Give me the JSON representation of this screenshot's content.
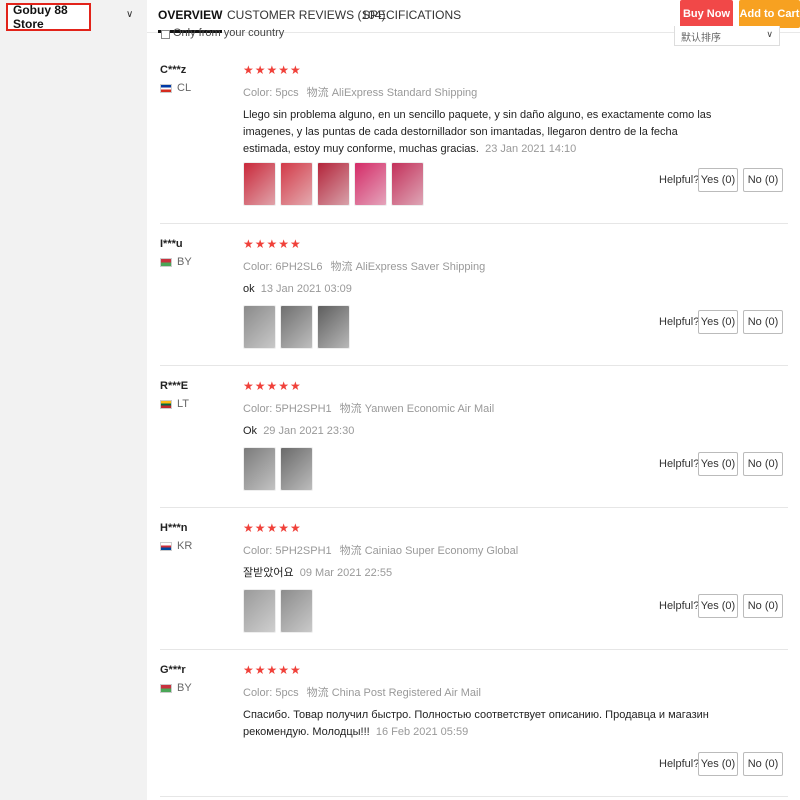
{
  "store": {
    "name": "Gobuy 88 Store",
    "chevron": "chevron-down-icon"
  },
  "tabs": [
    {
      "label": "OVERVIEW",
      "active": true
    },
    {
      "label": "CUSTOMER REVIEWS (104)",
      "active": false
    },
    {
      "label": "SPECIFICATIONS",
      "active": false
    }
  ],
  "actions": {
    "buy_now": "Buy Now",
    "add_to_cart": "Add to Cart"
  },
  "filters": {
    "country_label": "Only from your country",
    "sort_value": "默认排序"
  },
  "colors": {
    "accent": "#f14848",
    "cart": "#f7a121",
    "stars": "#f0413a"
  },
  "helpful_label": "Helpful?",
  "reviews": [
    {
      "name": "C***z",
      "country": "CL",
      "flag_colors": [
        "#0039a6",
        "#ffffff",
        "#d52b1e"
      ],
      "rating": 5,
      "stars": "★★★★★",
      "color_label": "Color:",
      "color_value": "5pcs",
      "logistics_label": "物流",
      "logistics_value": "AliExpress Standard Shipping",
      "text": "Llego sin problema alguno, en un sencillo paquete, y sin daño alguno, es exactamente como las imagenes, y las puntas de cada destornillador son imantadas, llegaron dentro de la fecha estimada, estoy muy conforme, muchas gracias.",
      "date": "23 Jan 2021 14:10",
      "photos": 5,
      "yes": "Yes (0)",
      "no": "No (0)"
    },
    {
      "name": "I***u",
      "country": "BY",
      "flag_colors": [
        "#c8313e",
        "#4aa657"
      ],
      "rating": 5,
      "stars": "★★★★★",
      "color_label": "Color:",
      "color_value": "6PH2SL6",
      "logistics_label": "物流",
      "logistics_value": "AliExpress Saver Shipping",
      "text": "ok",
      "date": "13 Jan 2021 03:09",
      "photos": 3,
      "yes": "Yes (0)",
      "no": "No (0)"
    },
    {
      "name": "R***E",
      "country": "LT",
      "flag_colors": [
        "#fdb913",
        "#006a44",
        "#c1272d"
      ],
      "rating": 5,
      "stars": "★★★★★",
      "color_label": "Color:",
      "color_value": "5PH2SPH1",
      "logistics_label": "物流",
      "logistics_value": "Yanwen Economic Air Mail",
      "text": "Ok",
      "date": "29 Jan 2021 23:30",
      "photos": 2,
      "yes": "Yes (0)",
      "no": "No (0)"
    },
    {
      "name": "H***n",
      "country": "KR",
      "flag_colors": [
        "#ffffff",
        "#cd2e3a",
        "#0047a0"
      ],
      "rating": 5,
      "stars": "★★★★★",
      "color_label": "Color:",
      "color_value": "5PH2SPH1",
      "logistics_label": "物流",
      "logistics_value": "Cainiao Super Economy Global",
      "text": "잘받았어요",
      "date": "09 Mar 2021 22:55",
      "photos": 2,
      "yes": "Yes (0)",
      "no": "No (0)"
    },
    {
      "name": "G***r",
      "country": "BY",
      "flag_colors": [
        "#c8313e",
        "#4aa657"
      ],
      "rating": 5,
      "stars": "★★★★★",
      "color_label": "Color:",
      "color_value": "5pcs",
      "logistics_label": "物流",
      "logistics_value": "China Post Registered Air Mail",
      "text": "Спасибо. Товар получил быстро. Полностью соответствует описанию. Продавца и магазин рекомендую. Молодцы!!!",
      "date": "16 Feb 2021 05:59",
      "photos": 0,
      "yes": "Yes (0)",
      "no": "No (0)"
    }
  ]
}
